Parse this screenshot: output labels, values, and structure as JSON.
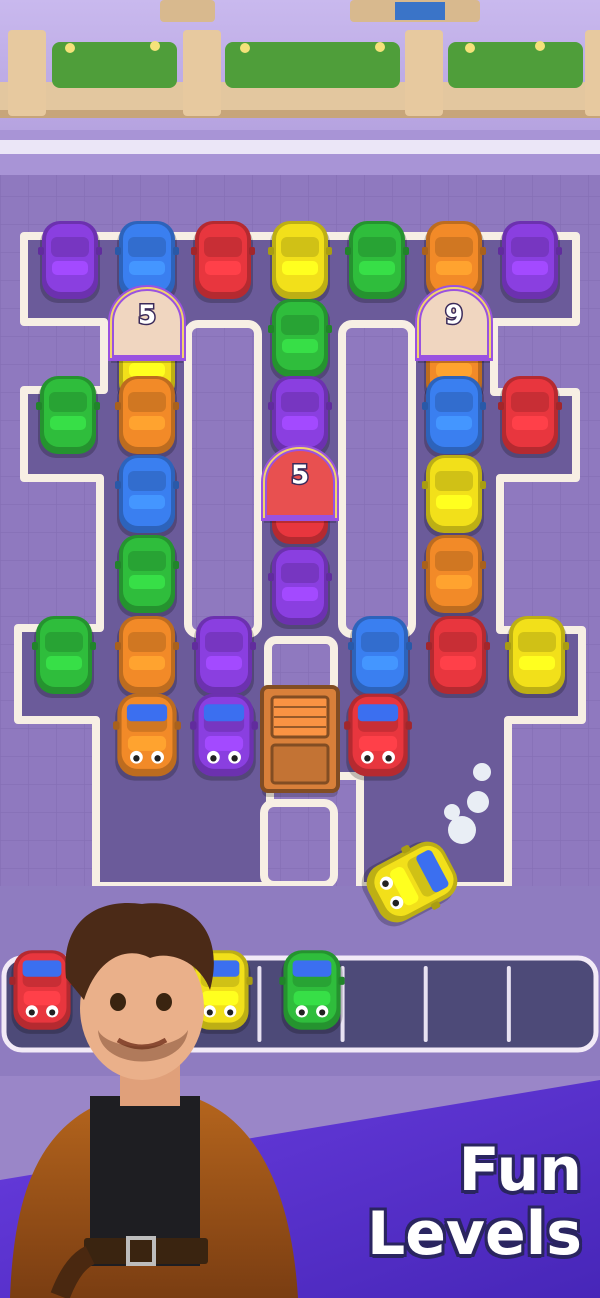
{
  "promo": {
    "line1": "Fun",
    "line2": "Levels"
  },
  "palette": {
    "purple": "#8a3fe0",
    "blue": "#3a7ff0",
    "red": "#e8363e",
    "yellow": "#f2e01a",
    "green": "#2fbd3c",
    "orange": "#f28a28"
  },
  "board": {
    "cars": [
      {
        "color": "purple"
      },
      {
        "color": "blue"
      },
      {
        "color": "red"
      },
      {
        "color": "yellow"
      },
      {
        "color": "green"
      },
      {
        "color": "orange"
      },
      {
        "color": "purple"
      },
      {
        "color": "yellow"
      },
      {
        "color": "green"
      },
      {
        "color": "orange"
      },
      {
        "color": "green"
      },
      {
        "color": "orange"
      },
      {
        "color": "purple"
      },
      {
        "color": "blue"
      },
      {
        "color": "red"
      },
      {
        "color": "blue"
      },
      {
        "color": "red"
      },
      {
        "color": "yellow"
      },
      {
        "color": "green"
      },
      {
        "color": "orange"
      },
      {
        "color": "purple"
      },
      {
        "color": "green"
      },
      {
        "color": "orange"
      },
      {
        "color": "purple"
      },
      {
        "color": "blue"
      },
      {
        "color": "red"
      },
      {
        "color": "yellow"
      },
      {
        "color": "orange"
      },
      {
        "color": "purple"
      },
      {
        "color": "red"
      }
    ],
    "tunnels": [
      {
        "count": "5",
        "color": "#f0d6c0"
      },
      {
        "count": "9",
        "color": "#f0d6c0"
      },
      {
        "count": "5",
        "color": "#e85050"
      }
    ],
    "crate": {
      "color": "#d9803a"
    },
    "moving_car": {
      "color": "yellow"
    }
  },
  "holding_slots": {
    "slot_count": 7,
    "cars": [
      {
        "color": "red"
      },
      {
        "color": "yellow"
      },
      {
        "color": "green"
      }
    ]
  },
  "character": {
    "name": "driver-character"
  }
}
